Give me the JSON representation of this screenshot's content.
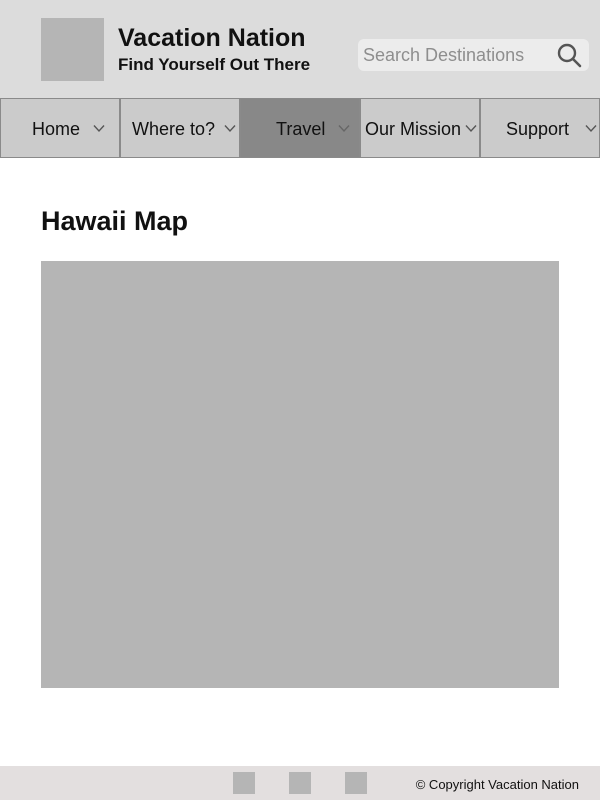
{
  "header": {
    "site_title": "Vacation Nation",
    "tagline": "Find Yourself Out There",
    "logo_icon": "logo-placeholder"
  },
  "search": {
    "placeholder": "Search Destinations",
    "value": "",
    "icon": "search-icon"
  },
  "nav": {
    "items": [
      {
        "label": "Home",
        "icon": "chevron-down-icon"
      },
      {
        "label": "Where to?",
        "icon": "chevron-down-icon"
      },
      {
        "label": "Travel",
        "icon": "chevron-down-icon",
        "active": true
      },
      {
        "label": "Our Mission",
        "icon": "chevron-down-icon"
      },
      {
        "label": "Support",
        "icon": "chevron-down-icon"
      }
    ],
    "active_color": "#888888"
  },
  "main": {
    "title": "Hawaii Map",
    "map_icon": "map-image-placeholder"
  },
  "footer": {
    "social_icons": [
      "social-icon-1",
      "social-icon-2",
      "social-icon-3"
    ],
    "copyright": "© Copyright Vacation Nation"
  },
  "colors": {
    "header_bg": "#dcdcdc",
    "nav_bg": "#cbcbcb",
    "placeholder_gray": "#b5b5b5",
    "footer_bg": "#e3dfdf"
  }
}
